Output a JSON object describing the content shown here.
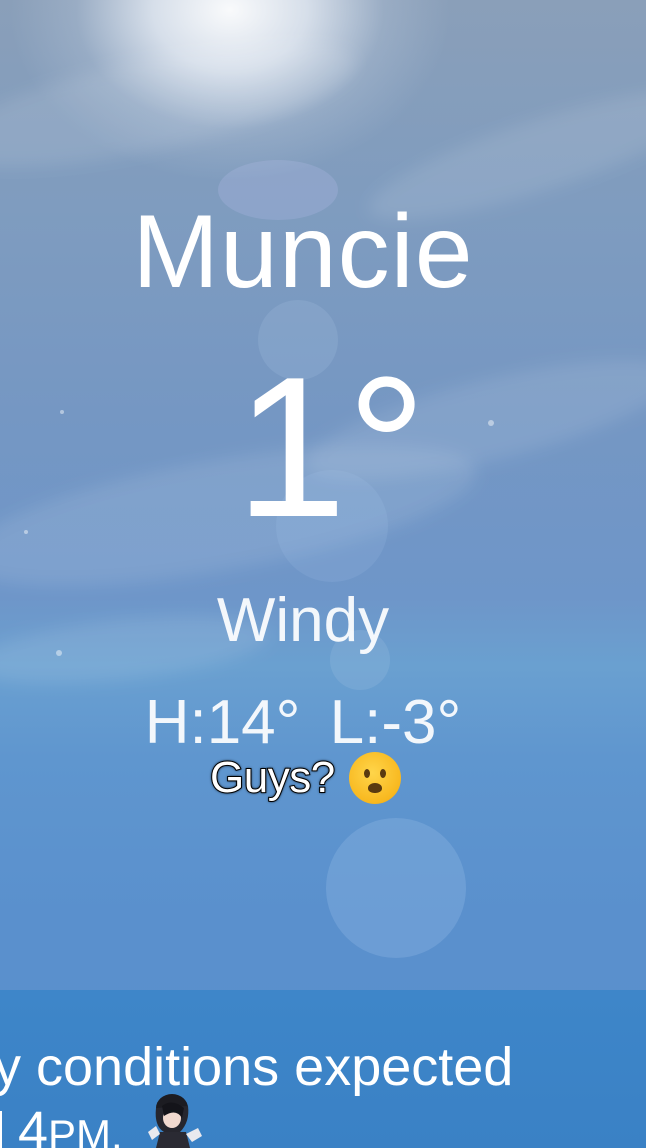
{
  "weather": {
    "city": "Muncie",
    "temperature": "1°",
    "condition": "Windy",
    "high_low": "H:14°  L:-3°"
  },
  "caption": {
    "text": "Guys?",
    "emoji_icon": "anguished-face-emoji"
  },
  "alert_banner": {
    "line1": "y conditions expected",
    "line2_time": "4",
    "line2_suffix": "PM."
  },
  "colors": {
    "sky_top": "#8a9fb9",
    "sky_bottom": "#5b8fcc",
    "banner": "#3e86c9",
    "text": "#ffffff"
  }
}
